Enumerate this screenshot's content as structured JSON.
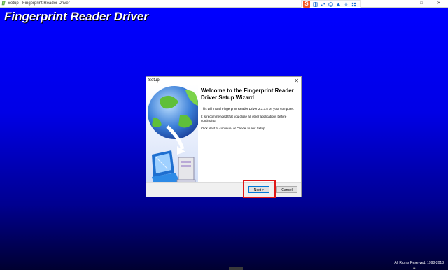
{
  "window": {
    "title": "Setup - Fingerprint Reader Driver",
    "minimize_glyph": "—",
    "maximize_glyph": "□",
    "close_glyph": "✕"
  },
  "ime": {
    "logo": "S",
    "icons": [
      "chinese-input-icon",
      "punctuation-icon",
      "emoji-icon",
      "skin-icon",
      "microphone-icon",
      "toolbox-icon"
    ]
  },
  "installer": {
    "banner_title": "Fingerprint Reader Driver",
    "copyright": "All Rights Reserved, 1998-2013",
    "taskbar_hint": "••"
  },
  "dialog": {
    "title": "Setup",
    "close_glyph": "✕",
    "heading": "Welcome to the Fingerprint Reader Driver Setup Wizard",
    "paragraphs": [
      "This will install Fingerprint Reader Driver 2.3.3.5 on your computer.",
      "It is recommended that you close all other applications before continuing.",
      "Click Next to continue, or Cancel to exit Setup."
    ],
    "buttons": {
      "next": "Next >",
      "cancel": "Cancel"
    }
  },
  "colors": {
    "background_top": "#0000ff",
    "background_bottom": "#000030",
    "highlight": "#e01818",
    "ime_brand": "#f25a26"
  }
}
